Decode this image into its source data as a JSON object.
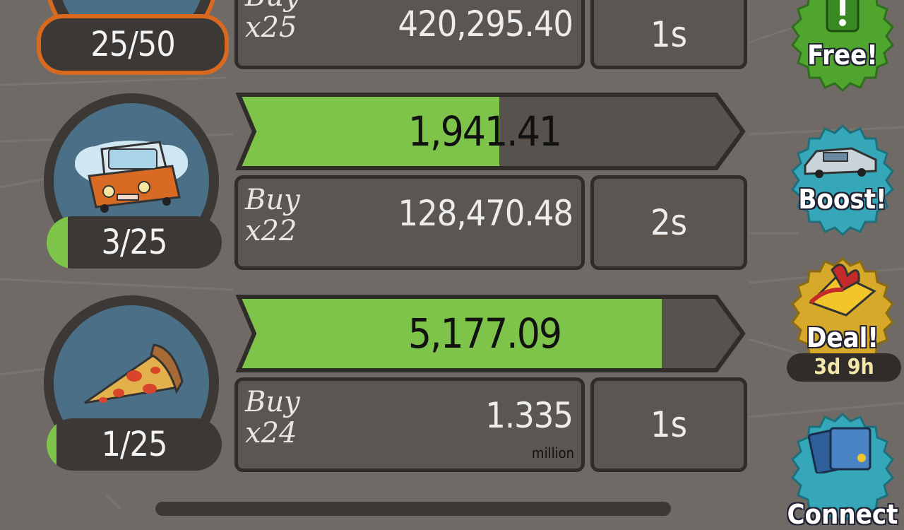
{
  "businesses": [
    {
      "name": "top-business",
      "count": "25/50",
      "buy_label_1": "Buy",
      "buy_label_2": "x25",
      "price": "420,295.40",
      "time": "1s"
    },
    {
      "name": "car-business",
      "icon": "car-icon",
      "count": "3/25",
      "count_fraction": 0.12,
      "progress_value": "1,941.41",
      "progress_fraction": 0.52,
      "buy_label_1": "Buy",
      "buy_label_2": "x22",
      "price": "128,470.48",
      "time": "2s"
    },
    {
      "name": "pizza-business",
      "icon": "pizza-icon",
      "count": "1/25",
      "count_fraction": 0.04,
      "progress_value": "5,177.09",
      "progress_fraction": 0.84,
      "buy_label_1": "Buy",
      "buy_label_2": "x24",
      "price": "1.335",
      "price_unit": "million",
      "time": "1s"
    }
  ],
  "side_buttons": {
    "free": {
      "label": "Free!",
      "color": "#4fa52e",
      "icon": "exclamation-icon"
    },
    "boost": {
      "label": "Boost!",
      "color": "#35a7b8",
      "icon": "time-machine-car-icon"
    },
    "deal": {
      "label": "Deal!",
      "timer": "3d 9h",
      "color": "#d6a92b",
      "icon": "gift-icon"
    },
    "connect": {
      "label": "Connect",
      "color": "#35a7b8",
      "icon": "cards-icon"
    }
  },
  "colors": {
    "background": "#6f6a65",
    "progress_fill": "#7ec44b",
    "panel": "#5b5652",
    "highlight_border": "#d86a1f"
  }
}
